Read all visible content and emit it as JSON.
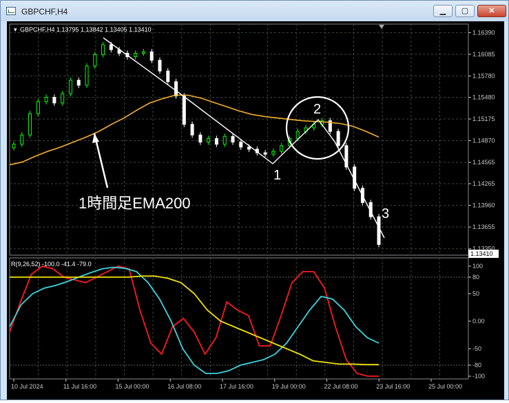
{
  "window": {
    "title": "GBPCHF,H4",
    "min_label": "▁",
    "max_label": "▢",
    "close_label": "✕"
  },
  "colors": {
    "bg": "#000000",
    "grid": "#3a4a3a",
    "axis": "#c8c8c8",
    "bull": "#00ff00",
    "bear": "#ffffff",
    "ema": "#f6b02a",
    "osc_red": "#ff1a1a",
    "osc_cyan": "#3ad6e0",
    "osc_yellow": "#f2e200",
    "annot": "#ffffff"
  },
  "chart_data": [
    {
      "type": "candlestick",
      "header": "GBPCHF,H4  1.13795 1.13842 1.13405 1.13410",
      "price_axis_labels": [
        "1.16390",
        "1.16085",
        "1.15780",
        "1.15480",
        "1.15175",
        "1.14870",
        "1.14565",
        "1.14265",
        "1.13960",
        "1.13655",
        "1.13350"
      ],
      "ylim": [
        1.1326,
        1.1651
      ],
      "current_price": "1.13410",
      "ema_series": {
        "name": "EMA200",
        "values": [
          1.1453,
          1.1457,
          1.1465,
          1.1472,
          1.1478,
          1.1485,
          1.1492,
          1.15,
          1.151,
          1.1519,
          1.153,
          1.154,
          1.1546,
          1.1551,
          1.1551,
          1.1547,
          1.1541,
          1.1535,
          1.1529,
          1.1524,
          1.1521,
          1.1519,
          1.1517,
          1.1515,
          1.1514,
          1.1513,
          1.1511,
          1.1507,
          1.15,
          1.1492
        ]
      },
      "candles_close": [
        1.1482,
        1.1495,
        1.1525,
        1.1542,
        1.1548,
        1.154,
        1.1553,
        1.1572,
        1.1565,
        1.1592,
        1.1608,
        1.1622,
        1.1615,
        1.161,
        1.1605,
        1.161,
        1.1612,
        1.16,
        1.1585,
        1.157,
        1.155,
        1.151,
        1.1495,
        1.1485,
        1.149,
        1.1482,
        1.1493,
        1.1485,
        1.1478,
        1.1475,
        1.147,
        1.1468,
        1.1472,
        1.148,
        1.149,
        1.15,
        1.1505,
        1.151,
        1.1515,
        1.15,
        1.148,
        1.145,
        1.142,
        1.14,
        1.138,
        1.1341
      ],
      "annotations": [
        "1",
        "2",
        "3",
        "1時間足EMA200"
      ]
    },
    {
      "type": "line",
      "header": "R(9,26,52) -100.0 -41.4 -79.0",
      "axis_labels": [
        "100",
        "80",
        "50",
        "0.00",
        "-50",
        "-80",
        "-100"
      ],
      "ylim": [
        -105,
        115
      ],
      "series": [
        {
          "values": [
            -20,
            35,
            85,
            100,
            95,
            80,
            75,
            70,
            80,
            90,
            100,
            95,
            20,
            -40,
            -60,
            -10,
            5,
            -20,
            -60,
            -30,
            35,
            20,
            10,
            -45,
            -45,
            10,
            70,
            90,
            90,
            60,
            -10,
            -70,
            -95,
            -100,
            -100
          ]
        },
        {
          "values": [
            -10,
            30,
            50,
            60,
            65,
            72,
            80,
            88,
            95,
            98,
            96,
            90,
            70,
            40,
            0,
            -50,
            -80,
            -95,
            -95,
            -90,
            -80,
            -75,
            -70,
            -60,
            -40,
            -10,
            20,
            45,
            40,
            20,
            -10,
            -30,
            -40
          ]
        },
        {
          "values": [
            80,
            80,
            80,
            80,
            80,
            80,
            80,
            80,
            80,
            80,
            82,
            82,
            78,
            70,
            50,
            20,
            0,
            -10,
            -20,
            -30,
            -40,
            -50,
            -60,
            -72,
            -75,
            -78,
            -78,
            -79,
            -79
          ]
        }
      ],
      "x_tick_labels": [
        "10 Jul 2024",
        "11 Jul 16:00",
        "15 Jul 00:00",
        "16 Jul 08:00",
        "17 Jul 16:00",
        "19 Jul 00:00",
        "22 Jul 08:00",
        "23 Jul 16:00",
        "25 Jul 00:00"
      ]
    }
  ]
}
